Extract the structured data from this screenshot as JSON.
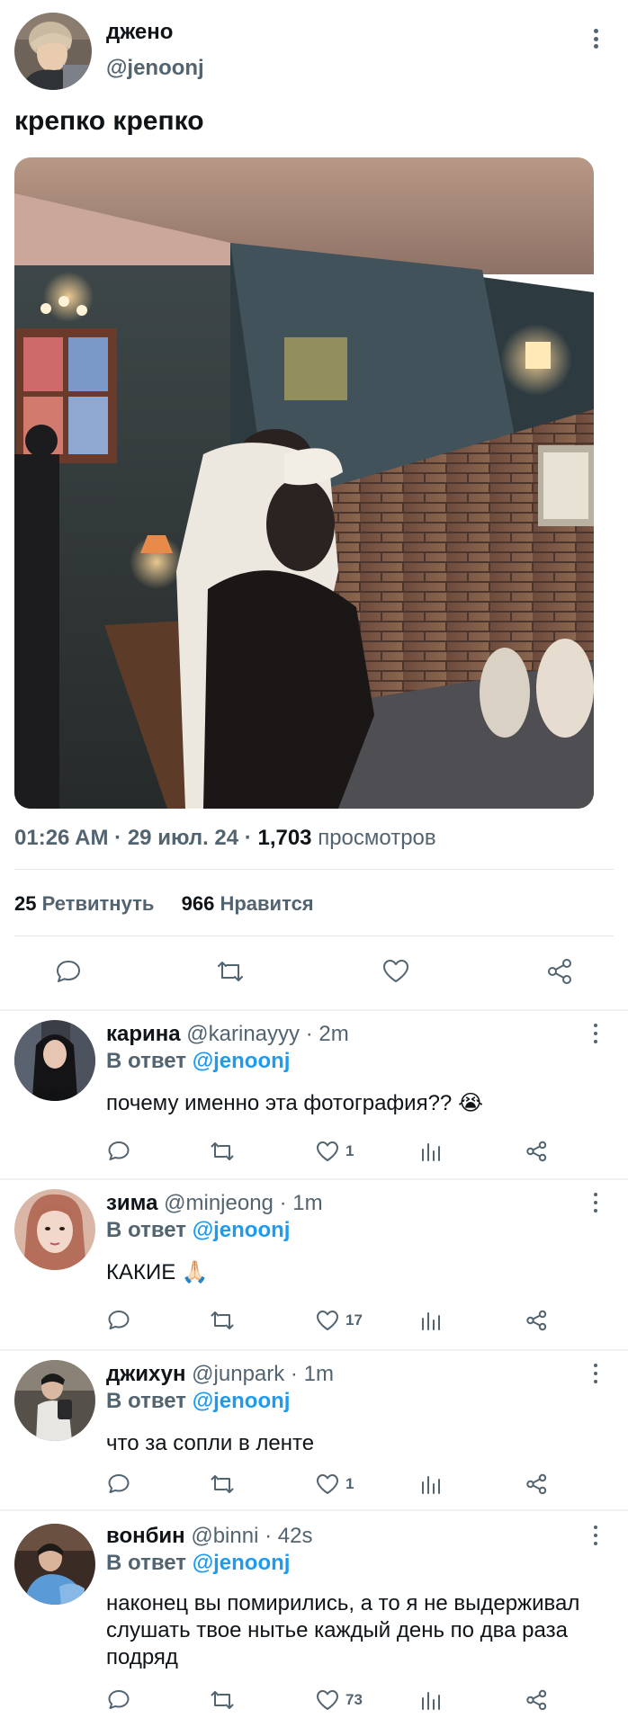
{
  "main_tweet": {
    "author_name": "джено",
    "author_handle": "@jenoonj",
    "text": "крепко крепко",
    "time": "01:26 AM",
    "date": "29 июл. 24",
    "views_count": "1,703",
    "views_label": "просмотров",
    "retweets_count": "25",
    "retweets_label": "Ретвитнуть",
    "likes_count": "966",
    "likes_label": "Нравится",
    "icons": [
      "reply-icon",
      "retweet-icon",
      "like-icon",
      "share-icon"
    ]
  },
  "reply_to_label": "В ответ",
  "replies": [
    {
      "name": "карина",
      "handle": "@karinayyy",
      "time": "2m",
      "reply_to": "@jenoonj",
      "text": "почему именно эта фотография?? 😭",
      "likes": "1"
    },
    {
      "name": "зима",
      "handle": "@minjeong",
      "time": "1m",
      "reply_to": "@jenoonj",
      "text": "КАКИЕ 🙏🏻",
      "likes": "17"
    },
    {
      "name": "джихун",
      "handle": "@junpark",
      "time": "1m",
      "reply_to": "@jenoonj",
      "text": "что за сопли в ленте",
      "likes": "1"
    },
    {
      "name": "вонбин",
      "handle": "@binni",
      "time": "42s",
      "reply_to": "@jenoonj",
      "text": "наконец вы помирились, а то я не выдерживал слушать твое нытье каждый день по два раза подряд",
      "likes": "73"
    }
  ],
  "colors": {
    "text": "#0f1419",
    "secondary": "#536471",
    "link": "#1d9bf0",
    "divider": "#e1e6ea"
  }
}
